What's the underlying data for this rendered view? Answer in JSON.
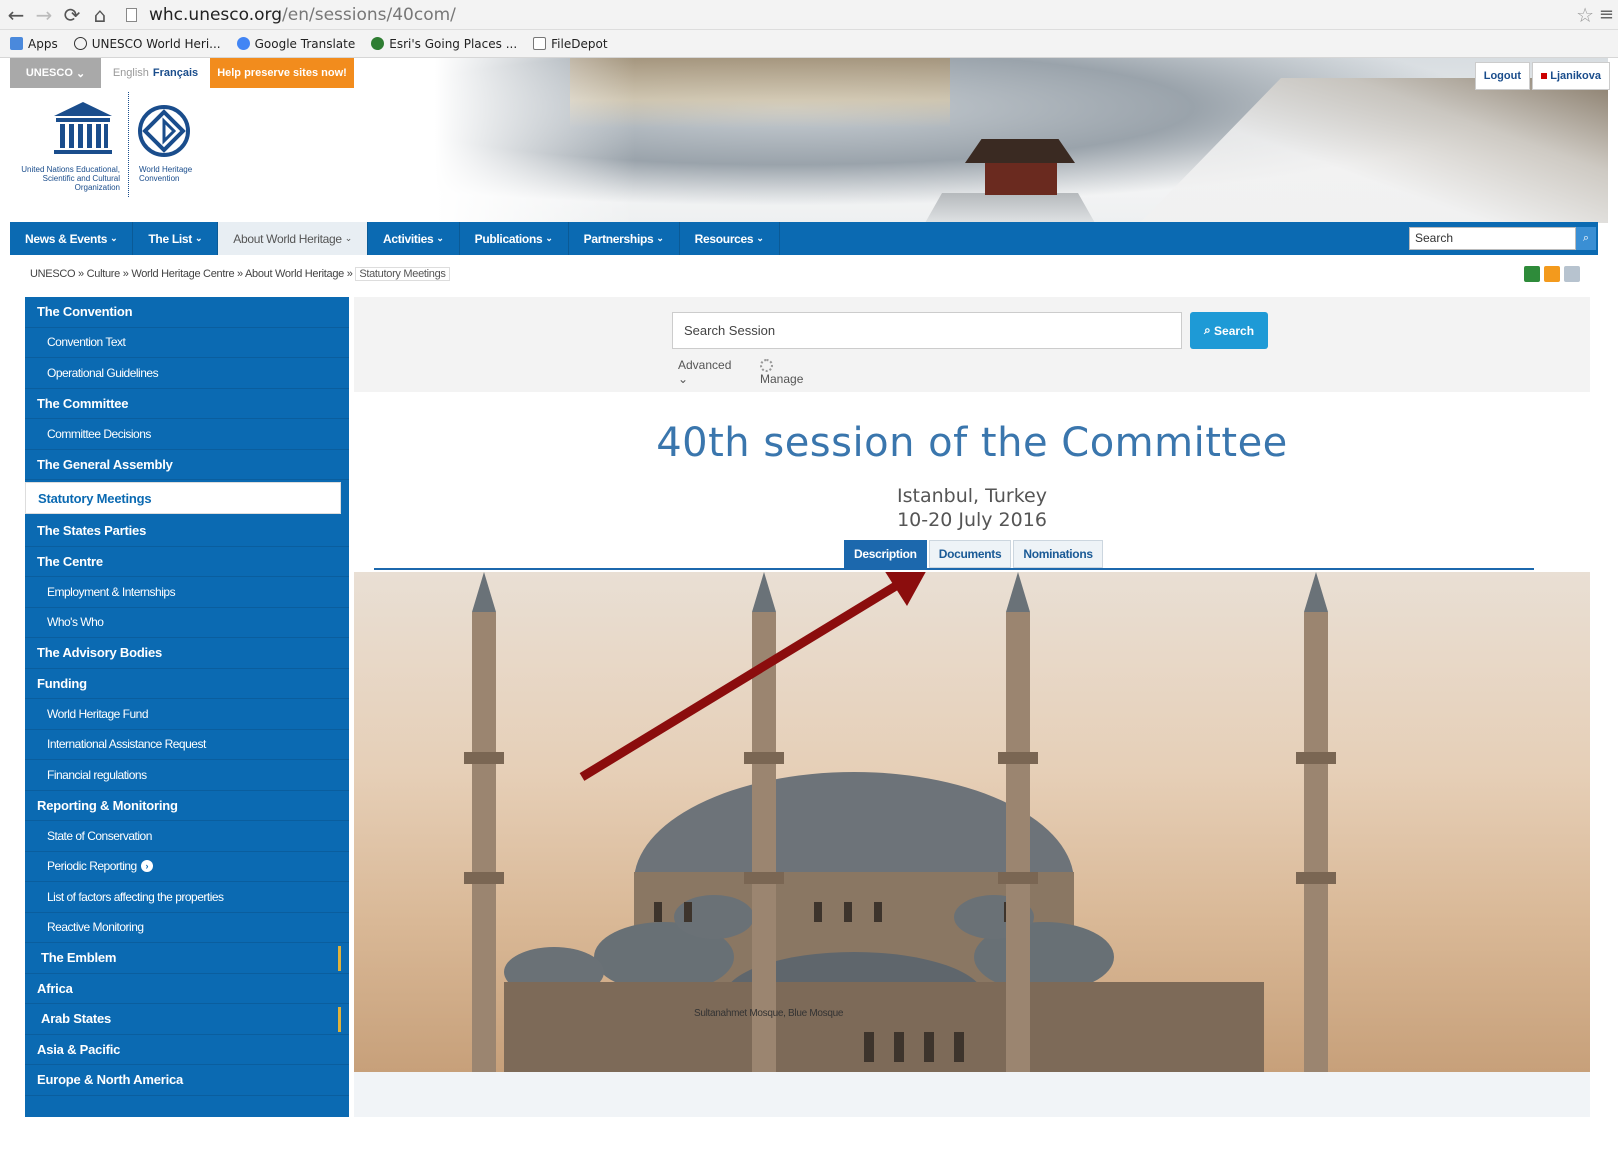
{
  "browser": {
    "url_host": "whc.unesco.org",
    "url_path": "/en/sessions/40com/",
    "bookmarks": [
      "Apps",
      "UNESCO World Heri...",
      "Google Translate",
      "Esri's Going Places ...",
      "FileDepot"
    ]
  },
  "header": {
    "unesco_menu": "UNESCO",
    "lang_en": "English",
    "lang_fr": "Français",
    "help_button": "Help preserve sites now!",
    "logout": "Logout",
    "user": "Ljanikova",
    "logo_unesco_text": "United Nations Educational, Scientific and Cultural Organization",
    "logo_whc_text": "World Heritage Convention"
  },
  "mainnav": {
    "items": [
      {
        "label": "News & Events"
      },
      {
        "label": "The List"
      },
      {
        "label": "About World Heritage"
      },
      {
        "label": "Activities"
      },
      {
        "label": "Publications"
      },
      {
        "label": "Partnerships"
      },
      {
        "label": "Resources"
      }
    ],
    "search_placeholder": "Search"
  },
  "breadcrumb": {
    "items": [
      "UNESCO",
      "Culture",
      "World Heritage Centre",
      "About World Heritage"
    ],
    "current": "Statutory Meetings"
  },
  "sidebar": {
    "items": [
      {
        "label": "The Convention",
        "kind": "section"
      },
      {
        "label": "Convention Text",
        "kind": "sub"
      },
      {
        "label": "Operational Guidelines",
        "kind": "sub"
      },
      {
        "label": "The Committee",
        "kind": "section"
      },
      {
        "label": "Committee Decisions",
        "kind": "sub"
      },
      {
        "label": "The General Assembly",
        "kind": "section"
      },
      {
        "label": "Statutory Meetings",
        "kind": "active"
      },
      {
        "label": "The States Parties",
        "kind": "section"
      },
      {
        "label": "The Centre",
        "kind": "section"
      },
      {
        "label": "Employment & Internships",
        "kind": "sub"
      },
      {
        "label": "Who's Who",
        "kind": "sub"
      },
      {
        "label": "The Advisory Bodies",
        "kind": "section"
      },
      {
        "label": "Funding",
        "kind": "section"
      },
      {
        "label": "World Heritage Fund",
        "kind": "sub"
      },
      {
        "label": "International Assistance Request",
        "kind": "sub"
      },
      {
        "label": "Financial regulations",
        "kind": "sub"
      },
      {
        "label": "Reporting & Monitoring",
        "kind": "section"
      },
      {
        "label": "State of Conservation",
        "kind": "sub"
      },
      {
        "label": "Periodic Reporting",
        "kind": "sub"
      },
      {
        "label": "List of factors affecting the properties",
        "kind": "sub"
      },
      {
        "label": "Reactive Monitoring",
        "kind": "sub"
      },
      {
        "label": "The Emblem",
        "kind": "marked"
      },
      {
        "label": "Africa",
        "kind": "section"
      },
      {
        "label": "Arab States",
        "kind": "marked"
      },
      {
        "label": "Asia & Pacific",
        "kind": "section"
      },
      {
        "label": "Europe & North America",
        "kind": "section"
      }
    ]
  },
  "session_search": {
    "placeholder": "Search Session",
    "button": "Search",
    "advanced": "Advanced",
    "manage": "Manage"
  },
  "session": {
    "title": "40th session of the Committee",
    "place": "Istanbul, Turkey",
    "dates": "10-20 July 2016",
    "tabs": [
      "Description",
      "Documents",
      "Nominations"
    ],
    "active_tab": "Description",
    "photo_caption": "Sultanahmet Mosque, Blue Mosque"
  },
  "colors": {
    "nav_blue": "#0b6ab2",
    "title_blue": "#3a76ad",
    "help_orange": "#f28c1d",
    "arrow_red": "#8b0d0d"
  }
}
